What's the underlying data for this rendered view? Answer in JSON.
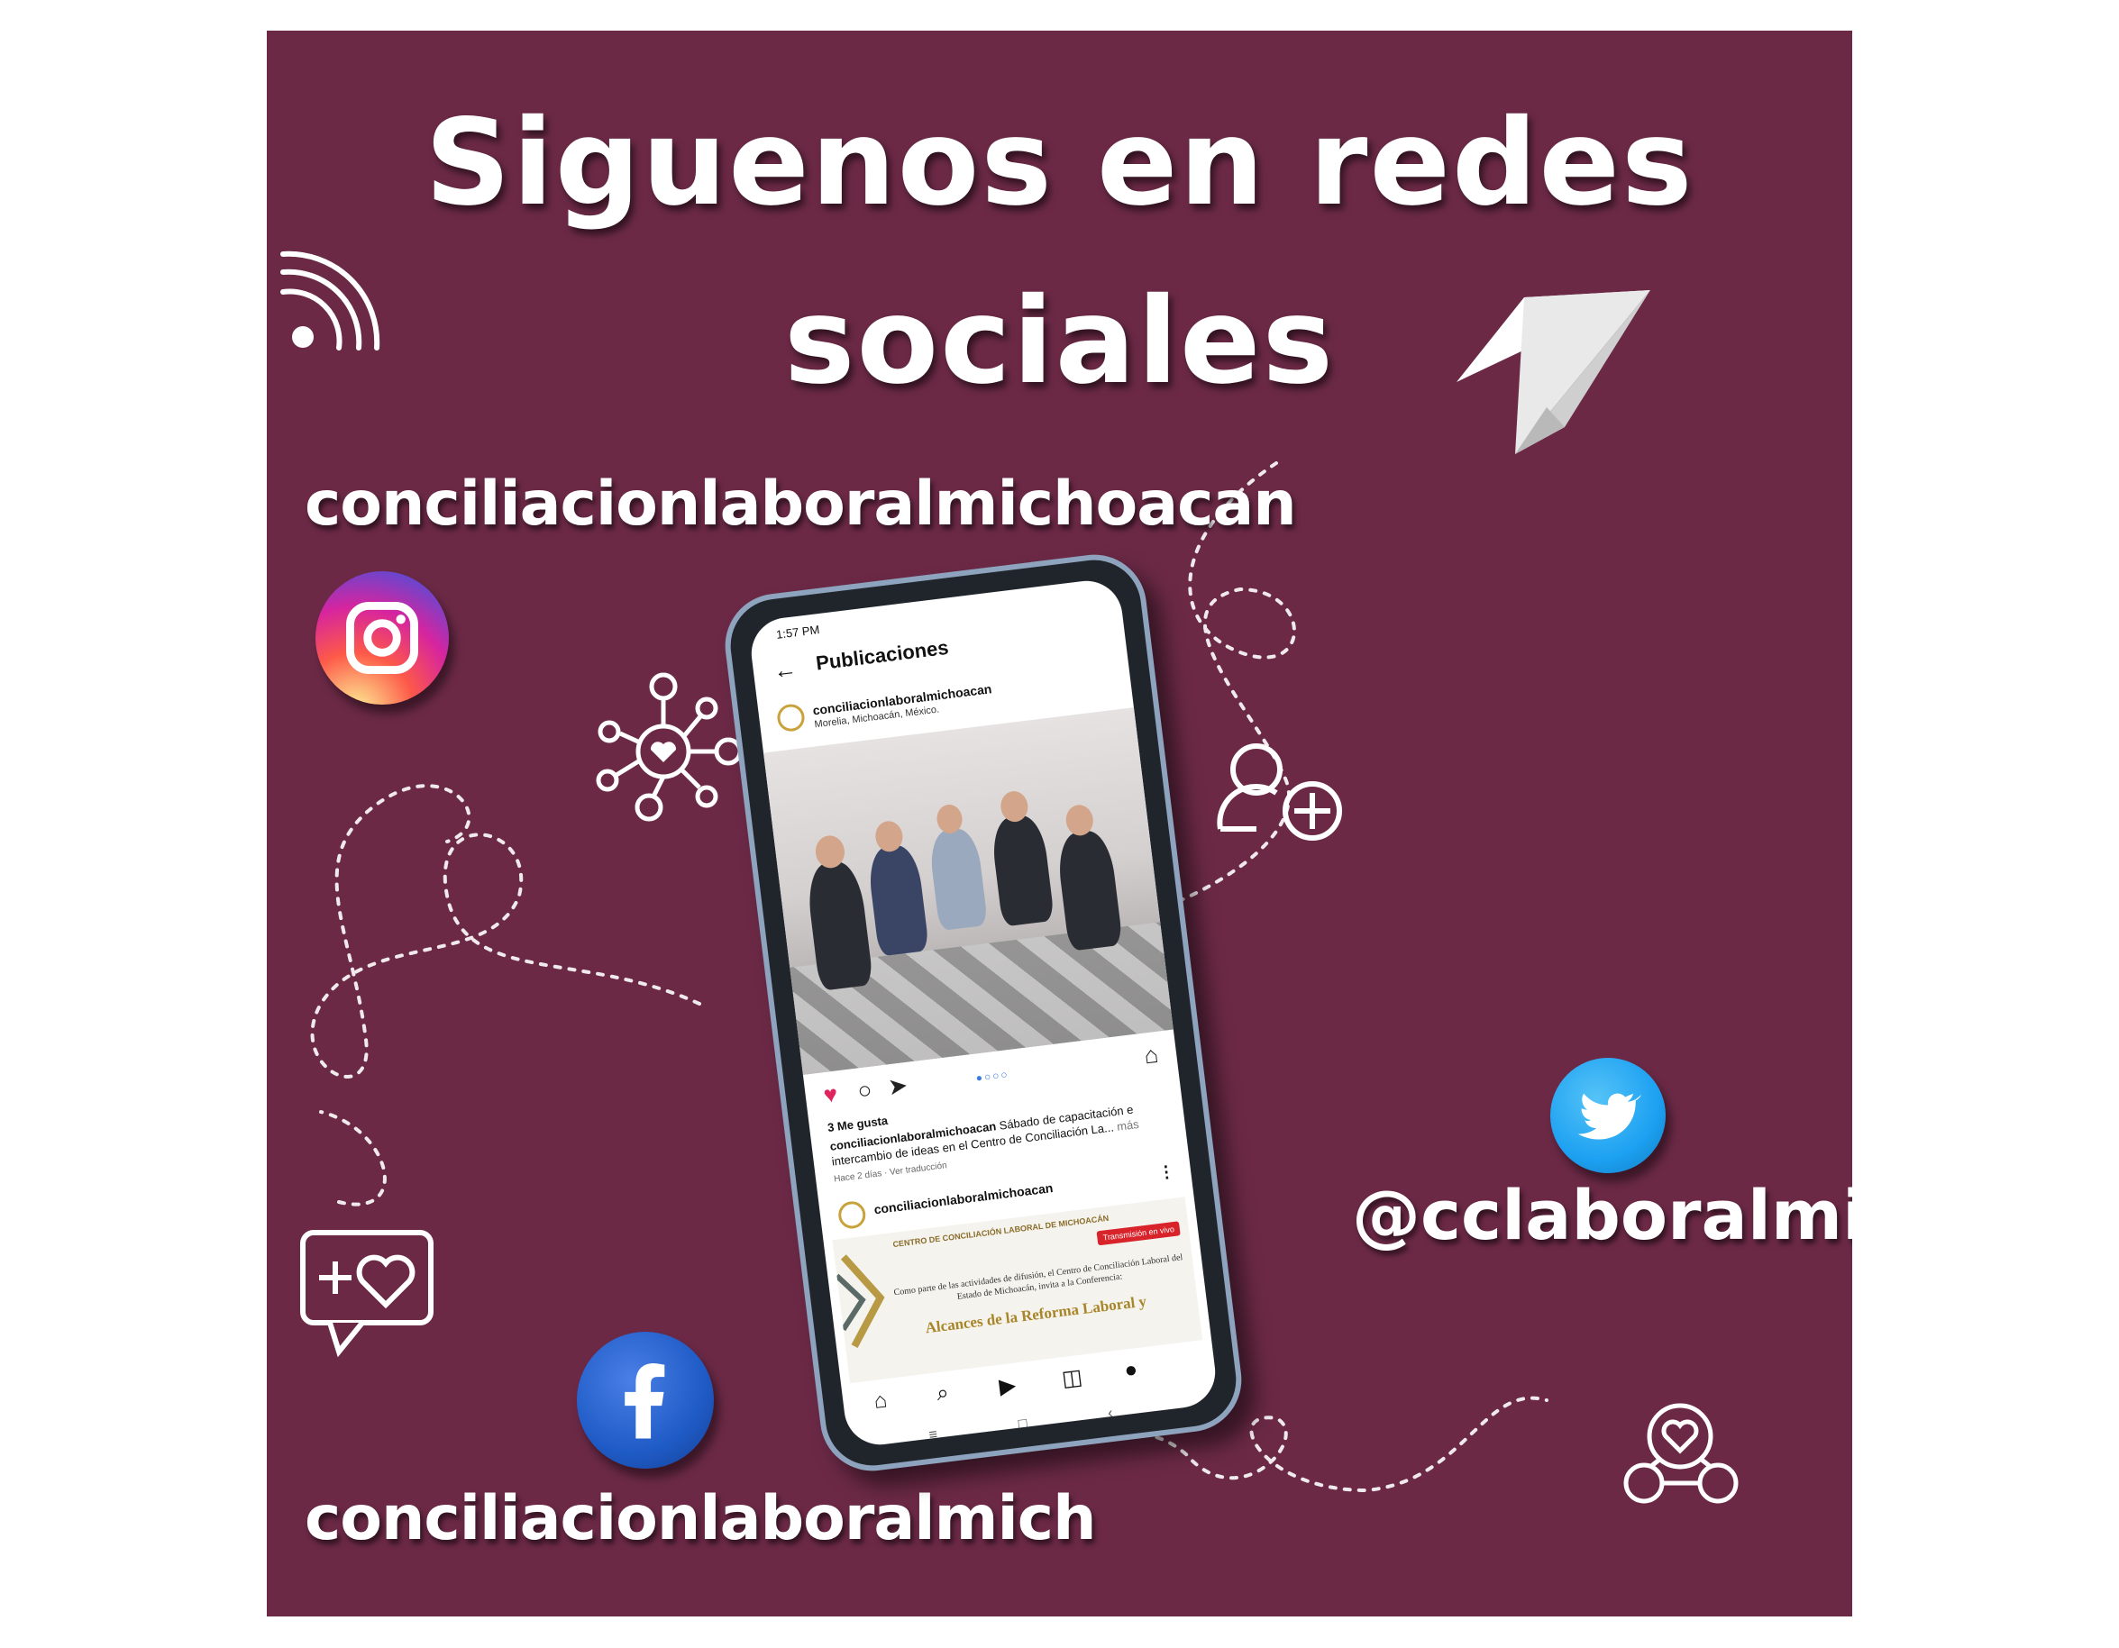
{
  "title": {
    "line1": "Siguenos en redes",
    "line2": "sociales"
  },
  "accounts": {
    "instagram": "conciliacionlaboralmichoacan",
    "twitter": "@cclaboralmich",
    "facebook": "conciliacionlaboralmich"
  },
  "colors": {
    "background": "#6b2946",
    "text": "#ffffff"
  },
  "icons": [
    "wifi-icon",
    "paper-plane-icon",
    "network-heart-icon",
    "add-user-icon",
    "add-favorite-icon",
    "community-heart-icon",
    "instagram-icon",
    "twitter-icon",
    "facebook-icon"
  ],
  "phone": {
    "status_time": "1:57 PM",
    "header": "Publicaciones",
    "post1": {
      "account": "conciliacionlaboralmichoacan",
      "location": "Morelia, Michoacán, México.",
      "likes": "3 Me gusta",
      "caption_account": "conciliacionlaboralmichoacan",
      "caption": "Sábado de capacitación e intercambio de ideas en el Centro de Conciliación La...",
      "more": "más",
      "meta": "Hace 2 días · Ver traducción"
    },
    "post2": {
      "account": "conciliacionlaboralmichoacan",
      "org": "CENTRO DE CONCILIACIÓN LABORAL DE MICHOACÁN",
      "live": "Transmisión en vivo",
      "text": "Como parte de las actividades de difusión, el Centro de Conciliación Laboral del Estado de Michoacán, invita a la Conferencia:",
      "headline": "Alcances de la Reforma Laboral y"
    }
  }
}
